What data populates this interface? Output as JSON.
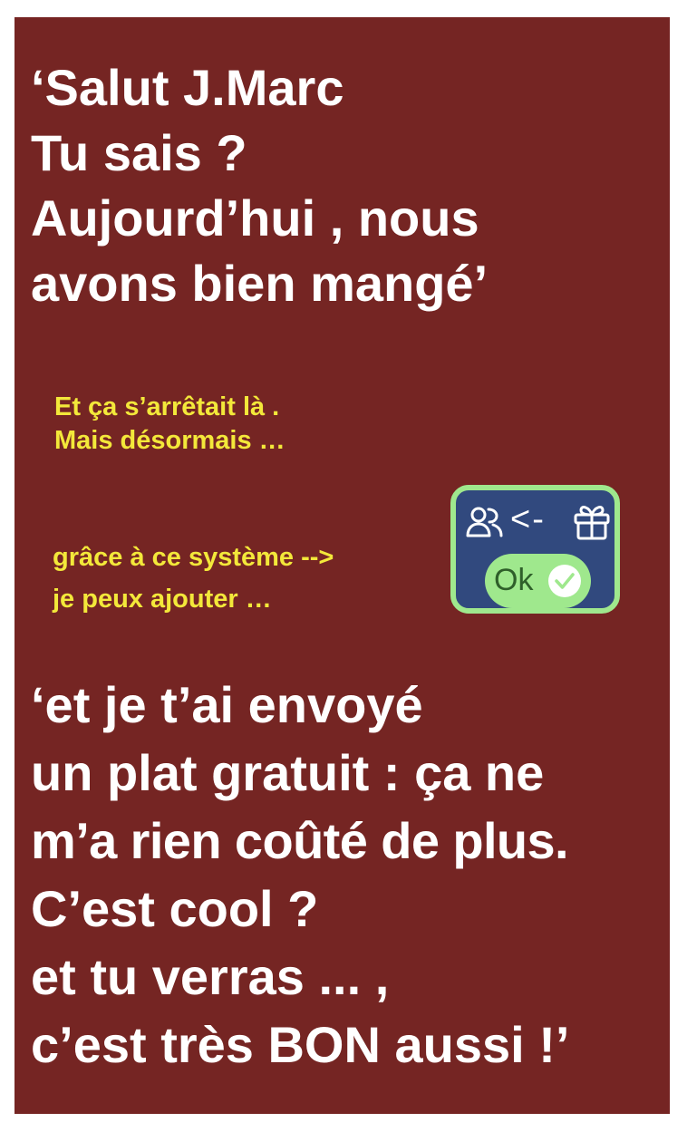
{
  "message": {
    "opening_lines": [
      "‘Salut J.Marc",
      "Tu sais ?",
      "Aujourd’hui , nous",
      "avons bien mangé’"
    ],
    "note_lines": [
      "Et ça s’arrêtait là .",
      "Mais désormais …"
    ],
    "system_lines": [
      "grâce à ce système -->",
      "je peux ajouter …"
    ],
    "closing_lines": [
      "‘et je t’ai envoyé",
      "un plat gratuit : ça ne",
      "m’a rien coûté de plus.",
      "C’est cool ?",
      "et tu verras ... ,",
      "c’est très BON aussi !’"
    ]
  },
  "badge": {
    "people_icon": "people-icon",
    "arrow_text": "<-",
    "gift_icon": "gift-icon",
    "toggle_label": "Ok",
    "check_icon": "check-circle-icon"
  },
  "colors": {
    "card_background": "#752523",
    "main_text": "#ffffff",
    "note_text": "#f3e83a",
    "badge_background": "#31497e",
    "badge_border": "#9fe88d",
    "toggle_background": "#9fe88d"
  }
}
